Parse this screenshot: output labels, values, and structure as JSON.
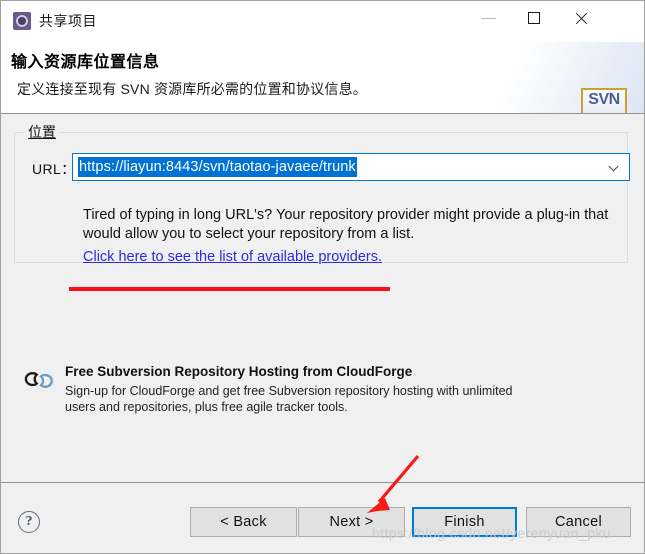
{
  "window": {
    "title": "共享项目",
    "icon": "gear-icon",
    "controls": {
      "minimize": "minimize-icon",
      "maximize": "maximize-icon",
      "close": "close-icon"
    }
  },
  "header": {
    "title": "输入资源库位置信息",
    "description": "定义连接至现有 SVN 资源库所必需的位置和协议信息。",
    "brand_icon_text": "SVN"
  },
  "location_group": {
    "legend": "位置",
    "url_label": "URL：",
    "url_value": "https://liayun:8443/svn/taotao-javaee/trunk",
    "url_placeholder": "",
    "hint": "Tired of typing in long URL's?  Your repository provider might provide a plug-in that would allow you to select your repository from a list.",
    "provider_link": "Click here to see the list of available providers.",
    "dropdown_icon": "chevron-down-icon"
  },
  "promo": {
    "icon": "cloud-icon",
    "title": "Free Subversion Repository Hosting from CloudForge",
    "body": "Sign-up for CloudForge and get free Subversion repository hosting with unlimited users and repositories, plus free agile tracker tools."
  },
  "footer": {
    "help_icon": "help-icon",
    "buttons": {
      "back": "< Back",
      "next": "Next >",
      "finish": "Finish",
      "cancel": "Cancel"
    }
  },
  "annotations": {
    "watermark": "https://blog.csdn.net/yerenyuan_pku",
    "arrow_color": "#f81a14",
    "underline_color": "#fc0d1b"
  },
  "colors": {
    "accent": "#0078d7",
    "selection": "#0072d4",
    "link": "#2b2be0",
    "dialog_bg": "#f0f0f0"
  }
}
